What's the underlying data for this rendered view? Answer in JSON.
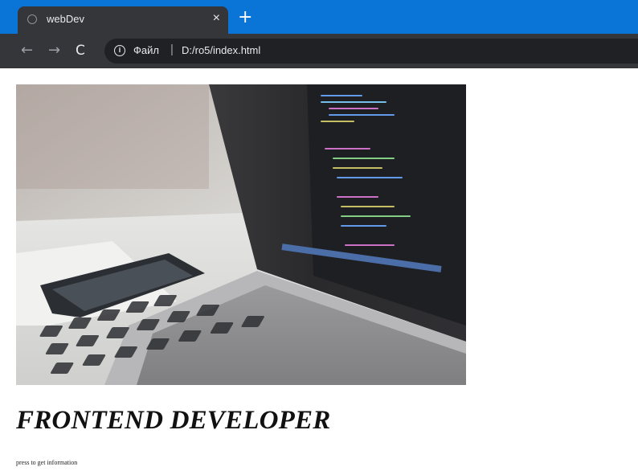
{
  "browser": {
    "tab": {
      "title": "webDev",
      "close_glyph": "×"
    },
    "new_tab_glyph": "+",
    "toolbar": {
      "back_glyph": "←",
      "forward_glyph": "→",
      "reload_glyph": "C",
      "info_glyph": "i",
      "scheme_label": "Файл",
      "separator": "|",
      "url": "D:/ro5/index.html"
    },
    "colors": {
      "accent": "#0b74d7",
      "tab": "#35363a",
      "omnibox": "#202124"
    }
  },
  "page": {
    "hero_image": {
      "icon": "laptop-code-photo"
    },
    "headline": "FRONTEND DEVELOPER",
    "hint": "press to get information"
  }
}
